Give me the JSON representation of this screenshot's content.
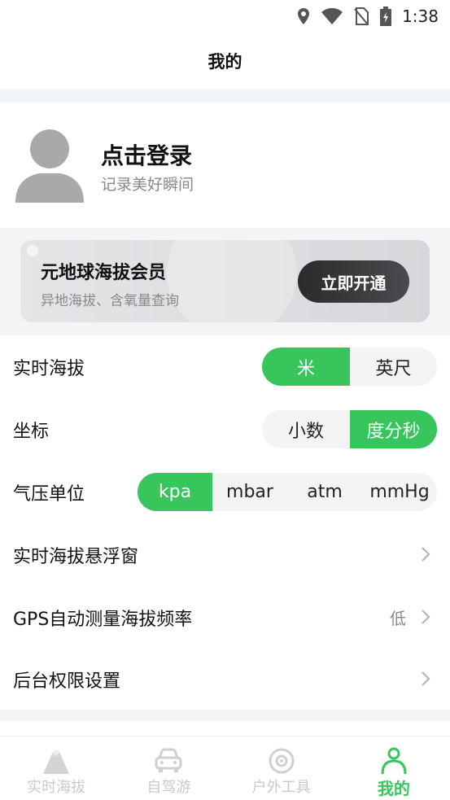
{
  "status": {
    "time": "1:38"
  },
  "header": {
    "title": "我的"
  },
  "profile": {
    "title": "点击登录",
    "subtitle": "记录美好瞬间"
  },
  "vip": {
    "title": "元地球海拔会员",
    "subtitle": "异地海拔、含氧量查询",
    "button": "立即开通"
  },
  "settings": {
    "altitude": {
      "label": "实时海拔",
      "options": [
        "米",
        "英尺"
      ],
      "selected": "米"
    },
    "coordinates": {
      "label": "坐标",
      "options": [
        "小数",
        "度分秒"
      ],
      "selected": "度分秒"
    },
    "pressure": {
      "label": "气压单位",
      "options": [
        "kpa",
        "mbar",
        "atm",
        "mmHg"
      ],
      "selected": "kpa"
    },
    "float_window": {
      "label": "实时海拔悬浮窗"
    },
    "gps_freq": {
      "label": "GPS自动测量海拔频率",
      "value": "低"
    },
    "background": {
      "label": "后台权限设置"
    }
  },
  "tabs": [
    {
      "label": "实时海拔",
      "icon": "mountain-icon"
    },
    {
      "label": "自驾游",
      "icon": "car-icon"
    },
    {
      "label": "户外工具",
      "icon": "compass-icon"
    },
    {
      "label": "我的",
      "icon": "person-icon",
      "active": true
    }
  ],
  "colors": {
    "accent": "#38c55c",
    "vip_button": "#333335"
  }
}
